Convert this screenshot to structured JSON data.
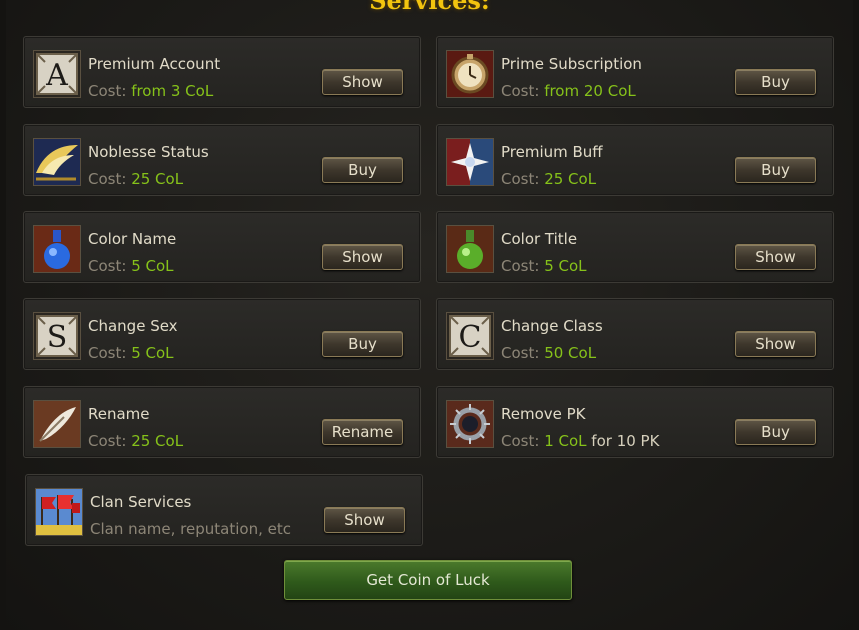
{
  "title": "Services:",
  "services": [
    {
      "name": "Premium Account",
      "cost_label": "Cost:",
      "cost_value": "from 3 CoL",
      "button": "Show",
      "icon": "letter-a-icon"
    },
    {
      "name": "Prime Subscription",
      "cost_label": "Cost:",
      "cost_value": "from 20 CoL",
      "button": "Buy",
      "icon": "pocket-watch-icon"
    },
    {
      "name": "Noblesse Status",
      "cost_label": "Cost:",
      "cost_value": "25 CoL",
      "button": "Buy",
      "icon": "wings-icon"
    },
    {
      "name": "Premium Buff",
      "cost_label": "Cost:",
      "cost_value": "25 CoL",
      "button": "Buy",
      "icon": "cross-burst-icon"
    },
    {
      "name": "Color Name",
      "cost_label": "Cost:",
      "cost_value": "5 CoL",
      "button": "Show",
      "icon": "blue-potion-icon"
    },
    {
      "name": "Color Title",
      "cost_label": "Cost:",
      "cost_value": "5 CoL",
      "button": "Show",
      "icon": "green-potion-icon"
    },
    {
      "name": "Change Sex",
      "cost_label": "Cost:",
      "cost_value": "5 CoL",
      "button": "Buy",
      "icon": "letter-s-icon"
    },
    {
      "name": "Change Class",
      "cost_label": "Cost:",
      "cost_value": "50 CoL",
      "button": "Show",
      "icon": "letter-c-icon"
    },
    {
      "name": "Rename",
      "cost_label": "Cost:",
      "cost_value": "25 CoL",
      "button": "Rename",
      "icon": "quill-icon"
    },
    {
      "name": "Remove PK",
      "cost_label": "Cost:",
      "cost_value": "1 CoL",
      "cost_tail": "for 10 PK",
      "button": "Buy",
      "icon": "spiked-ring-icon"
    },
    {
      "name": "Clan Services",
      "cost_label": "Clan name, reputation, etc",
      "cost_value": "",
      "button": "Show",
      "icon": "clan-flags-icon"
    }
  ],
  "get_coin_button": "Get Coin of Luck"
}
